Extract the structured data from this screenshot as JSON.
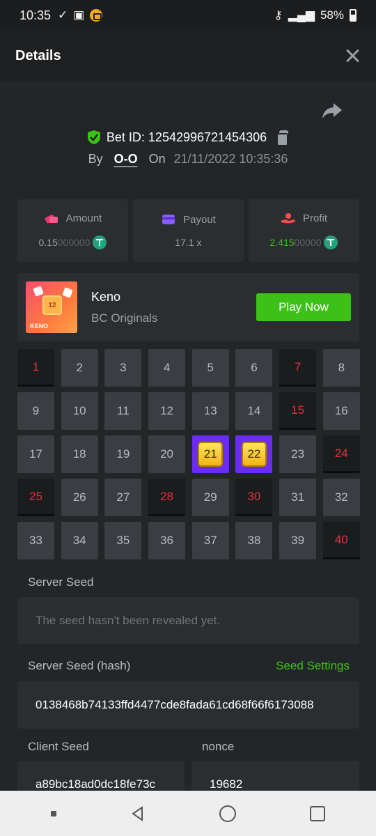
{
  "status_bar": {
    "time": "10:35",
    "battery": "58%"
  },
  "header": {
    "title": "Details"
  },
  "bet": {
    "id_label": "Bet ID:",
    "id": "12542996721454306",
    "by_label": "By",
    "user": "O-O",
    "on_label": "On",
    "date": "21/11/2022 10:35:36"
  },
  "stats": {
    "amount": {
      "label": "Amount",
      "value_main": "0.15",
      "value_dim": "000000"
    },
    "payout": {
      "label": "Payout",
      "value": "17.1 x"
    },
    "profit": {
      "label": "Profit",
      "value_main": "2.415",
      "value_dim": "00000"
    }
  },
  "game": {
    "name": "Keno",
    "provider": "BC Originals",
    "thumb_number": "12",
    "thumb_tag": "KENO",
    "play_label": "Play Now"
  },
  "keno": {
    "cells": [
      {
        "n": "1",
        "s": "drawn"
      },
      {
        "n": "2",
        "s": ""
      },
      {
        "n": "3",
        "s": ""
      },
      {
        "n": "4",
        "s": ""
      },
      {
        "n": "5",
        "s": ""
      },
      {
        "n": "6",
        "s": ""
      },
      {
        "n": "7",
        "s": "drawn"
      },
      {
        "n": "8",
        "s": ""
      },
      {
        "n": "9",
        "s": ""
      },
      {
        "n": "10",
        "s": ""
      },
      {
        "n": "11",
        "s": ""
      },
      {
        "n": "12",
        "s": ""
      },
      {
        "n": "13",
        "s": ""
      },
      {
        "n": "14",
        "s": ""
      },
      {
        "n": "15",
        "s": "drawn"
      },
      {
        "n": "16",
        "s": ""
      },
      {
        "n": "17",
        "s": ""
      },
      {
        "n": "18",
        "s": ""
      },
      {
        "n": "19",
        "s": ""
      },
      {
        "n": "20",
        "s": ""
      },
      {
        "n": "21",
        "s": "hit"
      },
      {
        "n": "22",
        "s": "hit"
      },
      {
        "n": "23",
        "s": ""
      },
      {
        "n": "24",
        "s": "drawn"
      },
      {
        "n": "25",
        "s": "drawn"
      },
      {
        "n": "26",
        "s": ""
      },
      {
        "n": "27",
        "s": ""
      },
      {
        "n": "28",
        "s": "drawn"
      },
      {
        "n": "29",
        "s": ""
      },
      {
        "n": "30",
        "s": "drawn"
      },
      {
        "n": "31",
        "s": ""
      },
      {
        "n": "32",
        "s": ""
      },
      {
        "n": "33",
        "s": ""
      },
      {
        "n": "34",
        "s": ""
      },
      {
        "n": "35",
        "s": ""
      },
      {
        "n": "36",
        "s": ""
      },
      {
        "n": "37",
        "s": ""
      },
      {
        "n": "38",
        "s": ""
      },
      {
        "n": "39",
        "s": ""
      },
      {
        "n": "40",
        "s": "drawn"
      }
    ]
  },
  "seeds": {
    "server_seed_label": "Server Seed",
    "server_seed_placeholder": "The seed hasn't been revealed yet.",
    "server_hash_label": "Server Seed (hash)",
    "seed_settings_label": "Seed Settings",
    "server_hash": "0138468b74133ffd4477cde8fada61cd68f66f6173088",
    "client_seed_label": "Client Seed",
    "client_seed": "a89bc18ad0dc18fe73c",
    "nonce_label": "nonce",
    "nonce": "19682"
  },
  "colors": {
    "accent_green": "#3bc117",
    "drawn_red": "#e0333c",
    "hit_purple": "#6a2cf0"
  }
}
